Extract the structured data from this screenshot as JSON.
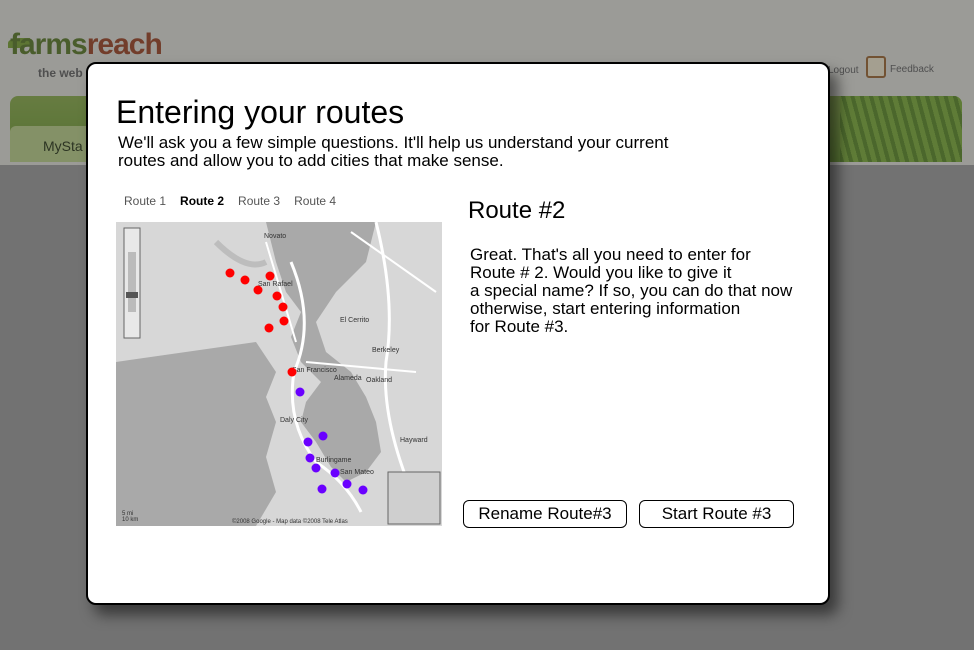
{
  "background": {
    "logo_main": "farms",
    "logo_accent": "reach",
    "logo_sub": "the web",
    "nav_tab": "MySta",
    "logout": "Logout",
    "feedback": "Feedback"
  },
  "modal": {
    "title": "Entering your routes",
    "subtitle": "We'll ask you a few simple questions. It'll help us understand your current routes and allow you to add cities that make sense.",
    "tabs": [
      {
        "label": "Route 1",
        "active": false
      },
      {
        "label": "Route 2",
        "active": true
      },
      {
        "label": "Route 3",
        "active": false
      },
      {
        "label": "Route 4",
        "active": false
      }
    ],
    "route_heading": "Route #2",
    "message_lines": [
      "Great. That's all you need to enter for",
      "Route # 2. Would you like to give it",
      "a special name? If so, you can do that now",
      "otherwise, start entering information",
      "for Route #3."
    ],
    "rename_button": "Rename Route#3",
    "start_button": "Start Route #3"
  },
  "map": {
    "copyright": "©2008 Google - Map data ©2008 Tele Atlas",
    "scale_mi": "5 mi",
    "scale_km": "10 km",
    "labels": {
      "novato": "Novato",
      "san_rafael": "San Rafael",
      "san_francisco": "San Francisco",
      "oakland": "Oakland",
      "alameda": "Alameda",
      "hayward": "Hayward",
      "el_cerrito": "El Cerrito",
      "berkeley": "Berkeley",
      "burlingame": "Burlingame",
      "daly_city": "Daly City",
      "san_mateo": "San Mateo"
    },
    "red_color": "#ff0000",
    "blue_color": "#6a00ff"
  }
}
